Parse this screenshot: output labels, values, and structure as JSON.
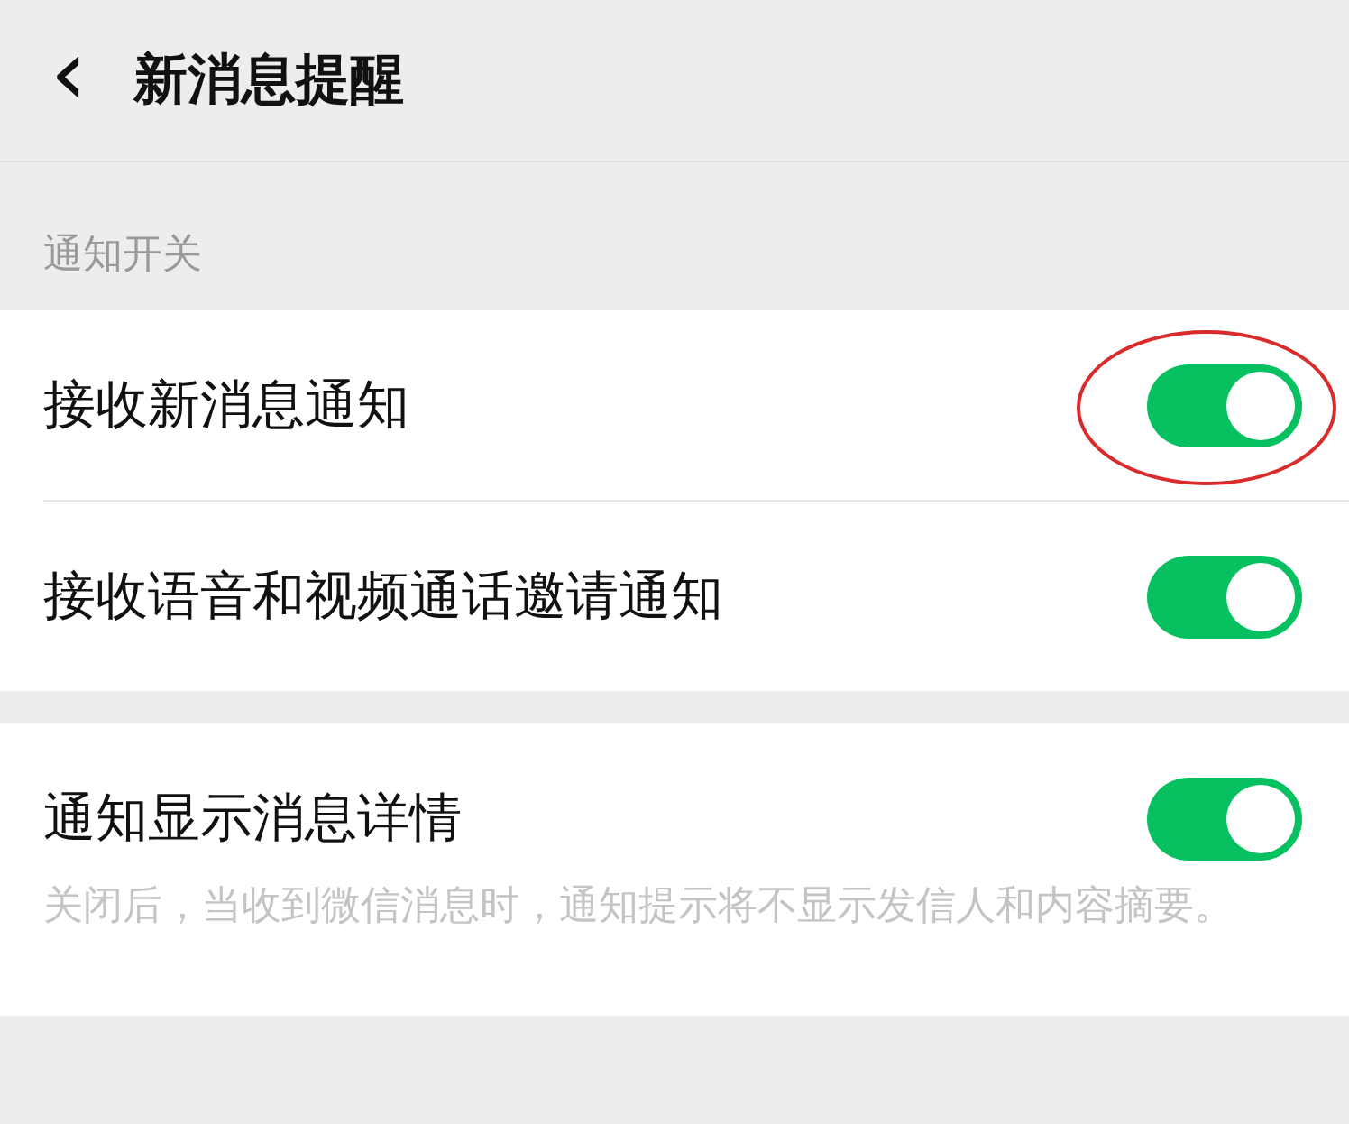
{
  "header": {
    "back": "‹",
    "title": "新消息提醒"
  },
  "section_label": "通知开关",
  "groups": [
    {
      "items": [
        {
          "label": "接收新消息通知",
          "on": true,
          "circled": true
        },
        {
          "label": "接收语音和视频通话邀请通知",
          "on": true,
          "circled": false
        }
      ]
    },
    {
      "items": [
        {
          "label": "通知显示消息详情",
          "on": true,
          "circled": false,
          "note": "关闭后，当收到微信消息时，通知提示将不显示发信人和内容摘要。"
        }
      ]
    }
  ]
}
